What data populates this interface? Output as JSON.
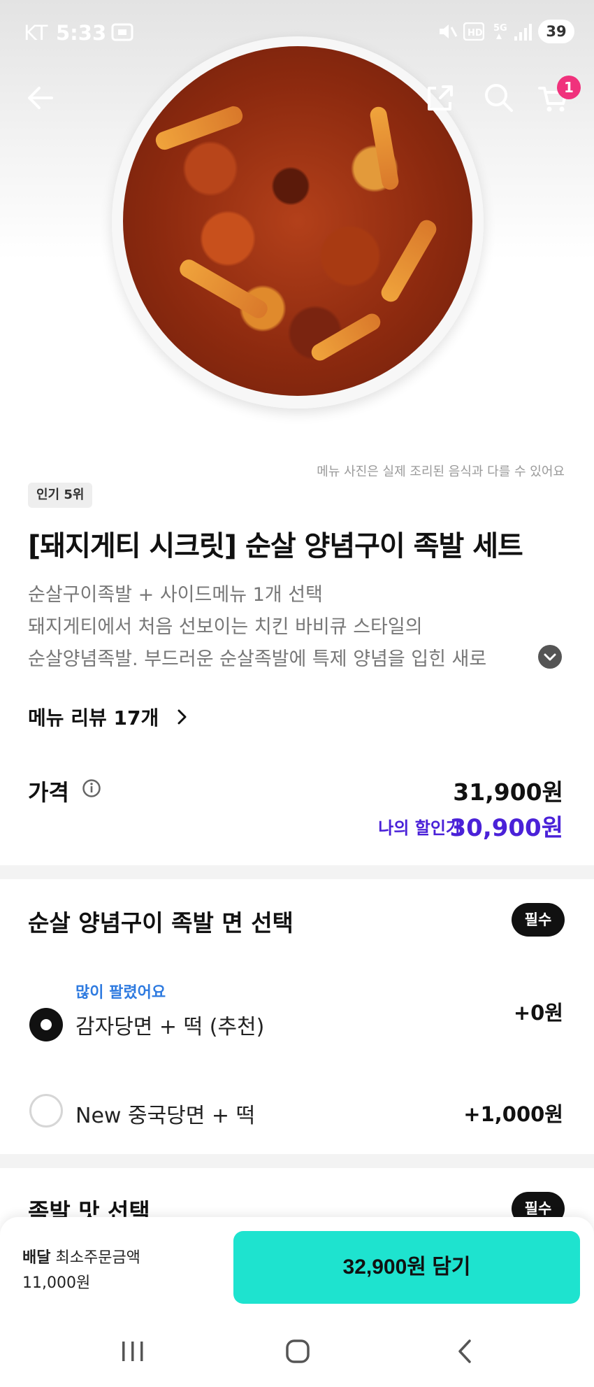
{
  "status_bar": {
    "carrier": "KT",
    "time": "5:33",
    "battery": "39"
  },
  "header": {
    "cart_count": "1",
    "icons": [
      "back-arrow-icon",
      "share-icon",
      "search-icon",
      "cart-icon"
    ]
  },
  "product": {
    "image_disclaimer": "메뉴 사진은 실제 조리된 음식과 다를 수 있어요",
    "rank_badge": "인기 5위",
    "title": "[돼지게티 시크릿] 순살 양념구이 족발 세트",
    "description_lines": [
      "순살구이족발 + 사이드메뉴 1개 선택",
      "돼지게티에서 처음 선보이는 치킨 바비큐 스타일의",
      "순살양념족발. 부드러운 순살족발에 특제 양념을 입힌 새로"
    ],
    "reviews_link": "메뉴 리뷰 17개",
    "price_label": "가격",
    "price": "31,900원",
    "discount_label": "나의 할인가",
    "discount_price": "30,900원"
  },
  "option_groups": [
    {
      "title": "순살 양념구이 족발 면 선택",
      "required_badge": "필수",
      "options": [
        {
          "tag": "많이 팔렸어요",
          "name": "감자당면 + 떡 (추천)",
          "price": "+0원",
          "selected": true
        },
        {
          "tag": "",
          "name": "New 중국당면 + 떡",
          "price": "+1,000원",
          "selected": false
        }
      ]
    },
    {
      "title": "족발 맛 선택",
      "required_badge": "필수"
    }
  ],
  "bottom_bar": {
    "delivery_label": "배달",
    "min_order_label": "최소주문금액",
    "min_order_value": "11,000원",
    "add_button": "32,900원 담기"
  },
  "colors": {
    "accent_discount": "#4a21d8",
    "add_button": "#1ee3cf",
    "cart_badge": "#f0327c",
    "hot_tag": "#2f7be0"
  }
}
